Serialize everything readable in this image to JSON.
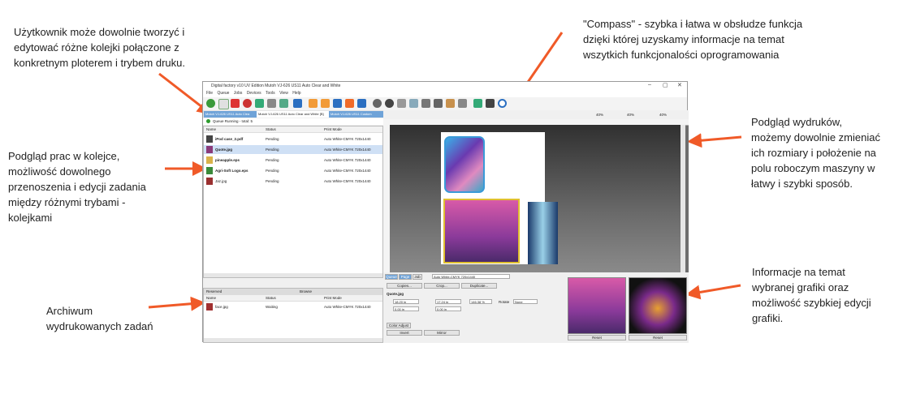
{
  "annotations": {
    "queues": "Użytkownik może dowolnie tworzyć i\nedytować różne kolejki połączone z\nkonkretnym ploterem i trybem druku.",
    "compass": "\"Compass\" - szybka i łatwa w obsłudze funkcja\ndzięki której uzyskamy informacje na temat\nwszytkich funkcjonalości oprogramowania",
    "jobs_preview": "Podgląd prac w kolejce,\nmożliwość dowolnego\nprzenoszenia i edycji zadania\nmiędzy różnymi trybami -\nkolejkami",
    "print_preview": "Podgląd wydruków,\nmożemy dowolnie zmieniać\nich rozmiary i położenie na\npolu roboczym maszyny w\nłatwy i szybki sposób.",
    "archive": "Archiwum\nwydrukowanych zadań",
    "graphic_info": "Informacje na temat\nwybranej grafiki oraz\nmożliwość szybkiej edycji\ngrafiki."
  },
  "colors": {
    "arrow": "#f05a28",
    "selection": "#cfe0f5",
    "tab_active": "#6fa3d8"
  },
  "app": {
    "title": "Digital factory v10 UV Edition Mutoh VJ-626 US11 Auto Clear and White",
    "window_controls": [
      "–",
      "▢",
      "✕"
    ],
    "menu": [
      "File",
      "Queue",
      "Jobs",
      "Devices",
      "Tools",
      "View",
      "Help"
    ],
    "queue_tabs": [
      "Mutoh VJ-626 US11 Auto Clea",
      "Mutoh VJ-626 US11 Auto Clear and White [B]",
      "Mutoh VJ-626 US11 Custom"
    ],
    "queue_status": "Queue Running - total: 5",
    "columns": {
      "name": "Name",
      "status": "Status",
      "mode": "Print Mode"
    },
    "jobs": [
      {
        "name": "iPod case_2.pdf",
        "status": "Pending",
        "mode": "Auto White-CMYK 720x1440"
      },
      {
        "name": "Quote.jpg",
        "status": "Pending",
        "mode": "Auto White-CMYK 720x1440"
      },
      {
        "name": "pineapple.eps",
        "status": "Pending",
        "mode": "Auto White-CMYK 720x1440"
      },
      {
        "name": "Agri-Soft Logo.eps",
        "status": "Pending",
        "mode": "Auto White-CMYK 720x1440"
      },
      {
        "name": "Jaz.jpg",
        "status": "Pending",
        "mode": "Auto White-CMYK 720x1440"
      }
    ],
    "archive_tabs": {
      "reserved": "Reserved",
      "browse": "Browse"
    },
    "archive_jobs": [
      {
        "name": "face.jpg",
        "status": "Waiting",
        "mode": "Auto White-CMYK 720x1440"
      }
    ],
    "preview": {
      "zoom_1": "40%",
      "zoom_2": "40%",
      "zoom_3": "40%"
    },
    "info": {
      "tabs": [
        "Queue",
        "Page",
        "Job"
      ],
      "mode": "Auto White-CMYK 720x1440",
      "buttons": [
        "Copies...",
        "Crop...",
        "Duplicate..."
      ],
      "filename": "Quote.jpg",
      "width": "18.20 in",
      "height": "17.24 in",
      "scale": "146.38 %",
      "rotate_label": "Rotate",
      "rotate_value": "None",
      "offset_x": "0.00 in",
      "offset_y": "0.00 in",
      "color_adjust": "Color Adjust",
      "invert": "Invert",
      "mirror": "Mirror"
    },
    "thumbs": {
      "reset_1": "Reset",
      "reset_2": "Reset"
    }
  }
}
